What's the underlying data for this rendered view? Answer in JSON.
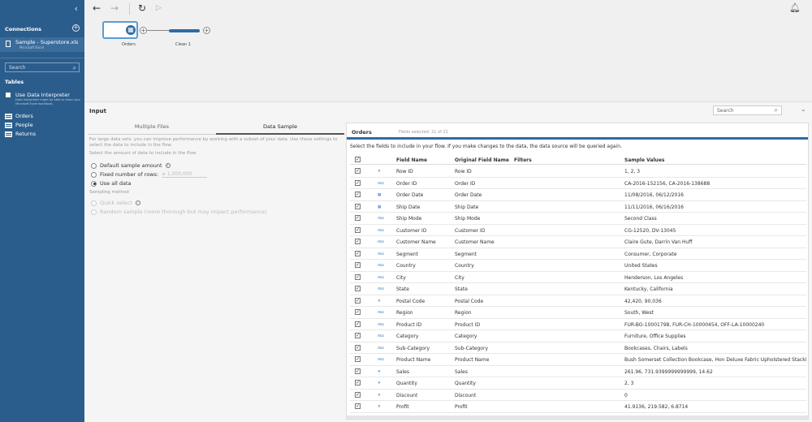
{
  "sidebar": {
    "collapse_icon": "chevron-left",
    "connections_label": "Connections",
    "connection": {
      "name": "Sample - Superstore.xls",
      "subtitle": "Microsoft Excel"
    },
    "search_placeholder": "Search",
    "tables_label": "Tables",
    "data_interpreter": {
      "label": "Use Data Interpreter",
      "description": "Data Interpreter might be able to clean your Microsoft Excel workbook."
    },
    "tables": [
      "Orders",
      "People",
      "Returns"
    ]
  },
  "flow": {
    "nodes": [
      {
        "label": "Orders"
      },
      {
        "label": "Clean 1"
      }
    ]
  },
  "panel": {
    "title": "Input",
    "search_placeholder": "Search",
    "tabs": [
      "Multiple Files",
      "Data Sample"
    ],
    "active_tab": "Data Sample",
    "description": "For large data sets, you can improve performance by working with a subset of your data. Use these settings to select the data to include in the flow.",
    "amount_label": "Select the amount of data to include in the flow",
    "options": [
      "Default sample amount",
      "Fixed number of rows:",
      "Use all data"
    ],
    "selected_option": "Use all data",
    "rows_placeholder": "≥ 1,000,000",
    "sampling_label": "Sampling method",
    "sampling_options": [
      "Quick select",
      "Random sample (more thorough but may impact performance)"
    ]
  },
  "fields": {
    "title": "Orders",
    "selected_text": "Fields selected: 21 of 21",
    "note": "Select the fields to include in your flow. If you make changes to the data, the data source will be queried again.",
    "headers": [
      "Field Name",
      "Original Field Name",
      "Filters",
      "Sample Values"
    ],
    "rows": [
      {
        "type": "#",
        "name": "Row ID",
        "orig": "Row ID",
        "sample": "1, 2, 3"
      },
      {
        "type": "Abc",
        "name": "Order ID",
        "orig": "Order ID",
        "sample": "CA-2016-152156, CA-2016-138688"
      },
      {
        "type": "date",
        "name": "Order Date",
        "orig": "Order Date",
        "sample": "11/08/2016, 06/12/2016"
      },
      {
        "type": "date",
        "name": "Ship Date",
        "orig": "Ship Date",
        "sample": "11/11/2016, 06/16/2016"
      },
      {
        "type": "Abc",
        "name": "Ship Mode",
        "orig": "Ship Mode",
        "sample": "Second Class"
      },
      {
        "type": "Abc",
        "name": "Customer ID",
        "orig": "Customer ID",
        "sample": "CG-12520, DV-13045"
      },
      {
        "type": "Abc",
        "name": "Customer Name",
        "orig": "Customer Name",
        "sample": "Claire Gute, Darrin Van Huff"
      },
      {
        "type": "Abc",
        "name": "Segment",
        "orig": "Segment",
        "sample": "Consumer, Corporate"
      },
      {
        "type": "Abc",
        "name": "Country",
        "orig": "Country",
        "sample": "United States"
      },
      {
        "type": "Abc",
        "name": "City",
        "orig": "City",
        "sample": "Henderson, Los Angeles"
      },
      {
        "type": "Abc",
        "name": "State",
        "orig": "State",
        "sample": "Kentucky, California"
      },
      {
        "type": "#",
        "name": "Postal Code",
        "orig": "Postal Code",
        "sample": "42,420, 90,036"
      },
      {
        "type": "Abc",
        "name": "Region",
        "orig": "Region",
        "sample": "South, West"
      },
      {
        "type": "Abc",
        "name": "Product ID",
        "orig": "Product ID",
        "sample": "FUR-BO-10001798, FUR-CH-10000454, OFF-LA-10000240"
      },
      {
        "type": "Abc",
        "name": "Category",
        "orig": "Category",
        "sample": "Furniture, Office Supplies"
      },
      {
        "type": "Abc",
        "name": "Sub-Category",
        "orig": "Sub-Category",
        "sample": "Bookcases, Chairs, Labels"
      },
      {
        "type": "Abc",
        "name": "Product Name",
        "orig": "Product Name",
        "sample": "Bush Somerset Collection Bookcase, Hon Deluxe Fabric Upholstered Stacki..."
      },
      {
        "type": "#",
        "name": "Sales",
        "orig": "Sales",
        "sample": "261.96, 731.9399999999999, 14.62"
      },
      {
        "type": "#",
        "name": "Quantity",
        "orig": "Quantity",
        "sample": "2, 3"
      },
      {
        "type": "#",
        "name": "Discount",
        "orig": "Discount",
        "sample": "0"
      },
      {
        "type": "#",
        "name": "Profit",
        "orig": "Profit",
        "sample": "41.9136, 219.582, 6.8714"
      }
    ]
  }
}
